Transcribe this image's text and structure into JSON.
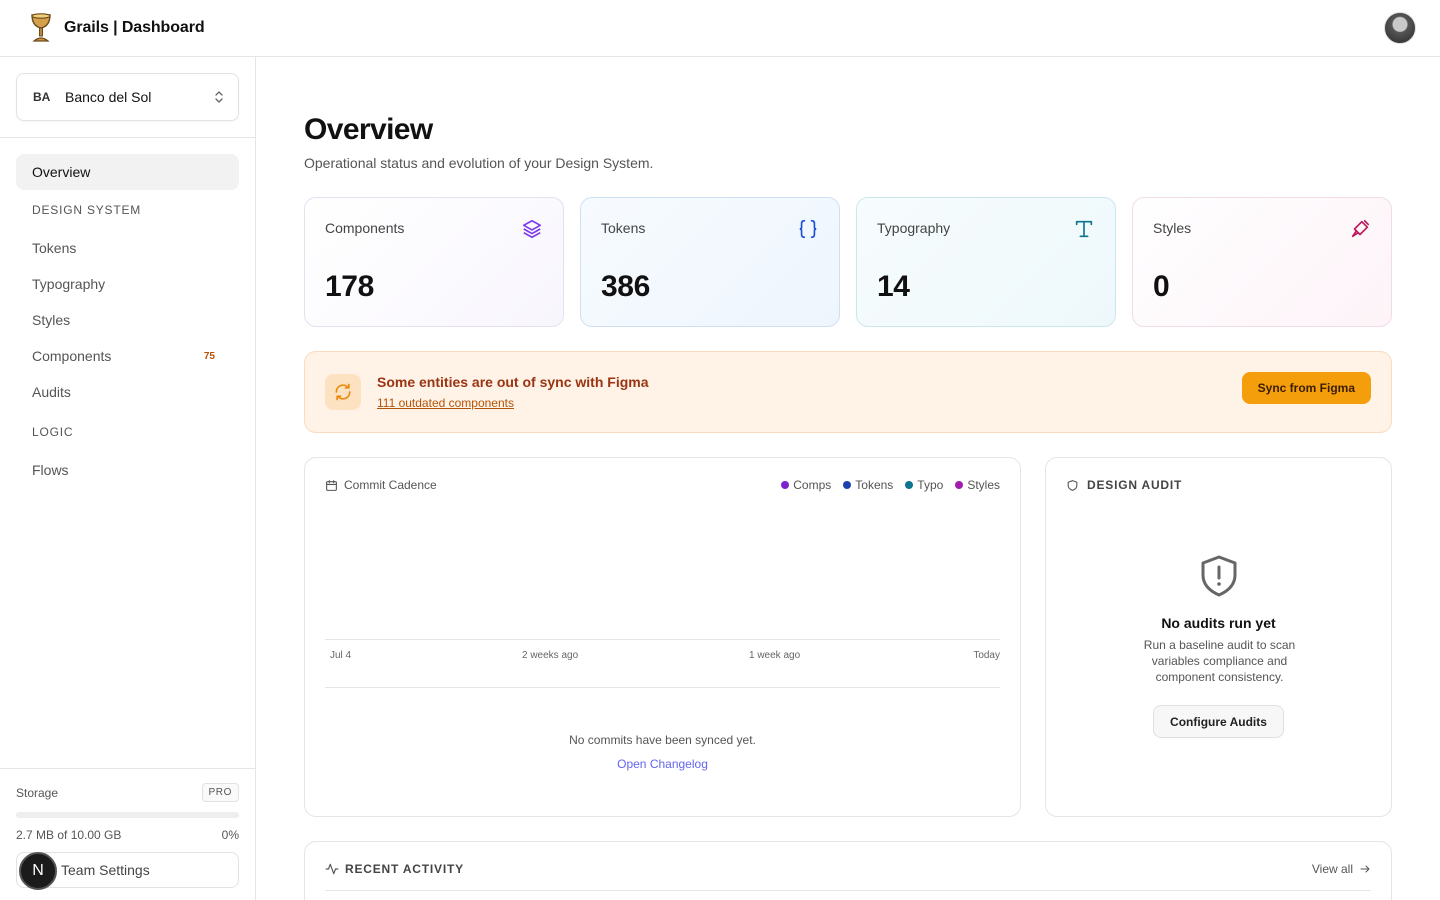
{
  "header": {
    "title": "Grails | Dashboard"
  },
  "org": {
    "initials": "BA",
    "name": "Banco del Sol"
  },
  "sidebar": {
    "overview": "Overview",
    "section_design": "DESIGN SYSTEM",
    "items": [
      {
        "label": "Tokens"
      },
      {
        "label": "Typography"
      },
      {
        "label": "Styles"
      },
      {
        "label": "Components",
        "badge": "75"
      },
      {
        "label": "Audits"
      }
    ],
    "section_logic": "LOGIC",
    "flows": "Flows"
  },
  "storage": {
    "label": "Storage",
    "plan": "PRO",
    "used": "2.7 MB of 10.00 GB",
    "percent": "0%",
    "fraction": 0.0,
    "team_settings": "Team Settings",
    "team_initial": "N"
  },
  "page": {
    "title": "Overview",
    "subtitle": "Operational status and evolution of your Design System."
  },
  "stats": [
    {
      "label": "Components",
      "value": "178",
      "icon": "layers-icon",
      "color": "#7c3aed"
    },
    {
      "label": "Tokens",
      "value": "386",
      "icon": "braces-icon",
      "color": "#1d4ed8"
    },
    {
      "label": "Typography",
      "value": "14",
      "icon": "type-icon",
      "color": "#0e7490"
    },
    {
      "label": "Styles",
      "value": "0",
      "icon": "brush-icon",
      "color": "#be185d"
    }
  ],
  "sync": {
    "title": "Some entities are out of sync with Figma",
    "link": "111 outdated components",
    "button": "Sync from Figma"
  },
  "cadence": {
    "title": "Commit Cadence",
    "legend": [
      {
        "name": "Comps",
        "color": "#7e22ce"
      },
      {
        "name": "Tokens",
        "color": "#1e40af"
      },
      {
        "name": "Typo",
        "color": "#0e7490"
      },
      {
        "name": "Styles",
        "color": "#a21caf"
      }
    ],
    "ticks": [
      "Jul 4",
      "2 weeks ago",
      "1 week ago",
      "Today"
    ],
    "empty": "No commits have been synced yet.",
    "link": "Open Changelog"
  },
  "audit": {
    "title": "DESIGN AUDIT",
    "empty_title": "No audits run yet",
    "empty_desc": "Run a baseline audit to scan variables compliance and component consistency.",
    "button": "Configure Audits"
  },
  "recent": {
    "title": "RECENT ACTIVITY",
    "view_all": "View all"
  }
}
